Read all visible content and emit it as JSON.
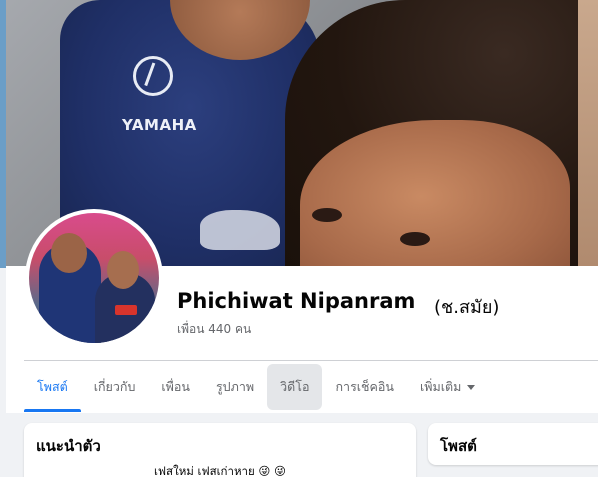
{
  "profile": {
    "name": "Phichiwat Nipanram",
    "alternate_name": "(ช.สมัย)",
    "friends_text": "เพื่อน 440 คน"
  },
  "cover": {
    "shirt_brand": "YAMAHA"
  },
  "tabs": [
    {
      "label": "โพสต์",
      "active": true
    },
    {
      "label": "เกี่ยวกับ",
      "active": false
    },
    {
      "label": "เพื่อน",
      "active": false
    },
    {
      "label": "รูปภาพ",
      "active": false
    },
    {
      "label": "วิดีโอ",
      "active": false
    },
    {
      "label": "การเช็คอิน",
      "active": false
    },
    {
      "label": "เพิ่มเติม",
      "active": false
    }
  ],
  "intro": {
    "title": "แนะนำตัว",
    "bio": "เฟสใหม่ เฟสเก่าหาย 😜 😜"
  },
  "posts": {
    "title": "โพสต์"
  },
  "colors": {
    "accent": "#1877f2",
    "background": "#f0f2f5",
    "text_secondary": "#65676b"
  }
}
